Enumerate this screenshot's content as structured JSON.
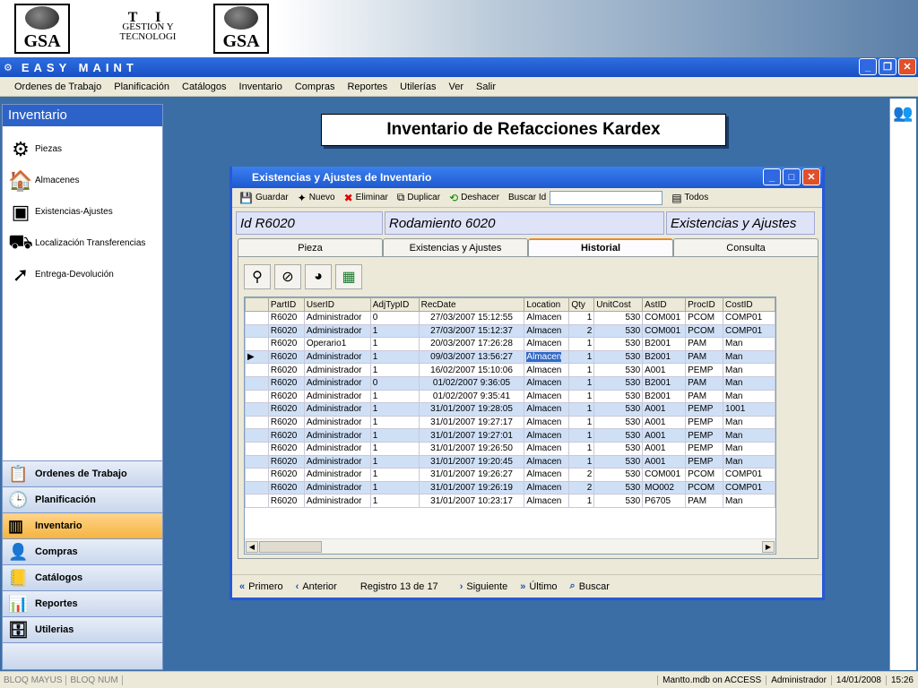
{
  "banner": {
    "logo_text": "GSA",
    "center_line1": "T I",
    "center_line2": "GESTION Y",
    "center_line3": "TECNOLOGI"
  },
  "app_title": "EASY MAINT",
  "menu": [
    "Ordenes de Trabajo",
    "Planificación",
    "Catálogos",
    "Inventario",
    "Compras",
    "Reportes",
    "Utilerías",
    "Ver",
    "Salir"
  ],
  "sidebar": {
    "title": "Inventario",
    "items": [
      {
        "label": "Piezas",
        "icon": "gears-icon"
      },
      {
        "label": "Almacenes",
        "icon": "warehouse-icon"
      },
      {
        "label": "Existencias-Ajustes",
        "icon": "boxes-icon"
      },
      {
        "label": "Localización Transferencias",
        "icon": "forklift-icon"
      },
      {
        "label": "Entrega-Devolución",
        "icon": "delivery-icon"
      }
    ],
    "nav": [
      {
        "label": "Ordenes de Trabajo",
        "active": false
      },
      {
        "label": "Planificación",
        "active": false
      },
      {
        "label": "Inventario",
        "active": true
      },
      {
        "label": "Compras",
        "active": false
      },
      {
        "label": "Catálogos",
        "active": false
      },
      {
        "label": "Reportes",
        "active": false
      },
      {
        "label": "Utilerias",
        "active": false
      }
    ]
  },
  "heading": "Inventario de Refacciones Kardex",
  "dialog": {
    "title": "Existencias y Ajustes de Inventario",
    "toolbar": {
      "save": "Guardar",
      "new": "Nuevo",
      "delete": "Eliminar",
      "duplicate": "Duplicar",
      "undo": "Deshacer",
      "search_id": "Buscar Id",
      "search_value": "",
      "all": "Todos"
    },
    "id_label": "Id R6020",
    "description": "Rodamiento 6020",
    "section": "Existencias y Ajustes",
    "tabs": [
      "Pieza",
      "Existencias y Ajustes",
      "Historial",
      "Consulta"
    ],
    "active_tab": 2,
    "columns": [
      "PartID",
      "UserID",
      "AdjTypID",
      "RecDate",
      "Location",
      "Qty",
      "UnitCost",
      "AstID",
      "ProcID",
      "CostID"
    ],
    "rows": [
      [
        "R6020",
        "Administrador",
        "0",
        "27/03/2007 15:12:55",
        "Almacen",
        "1",
        "530",
        "COM001",
        "PCOM",
        "COMP01"
      ],
      [
        "R6020",
        "Administrador",
        "1",
        "27/03/2007 15:12:37",
        "Almacen",
        "2",
        "530",
        "COM001",
        "PCOM",
        "COMP01"
      ],
      [
        "R6020",
        "Operario1",
        "1",
        "20/03/2007 17:26:28",
        "Almacen",
        "1",
        "530",
        "B2001",
        "PAM",
        "Man"
      ],
      [
        "R6020",
        "Administrador",
        "1",
        "09/03/2007 13:56:27",
        "Almacen",
        "1",
        "530",
        "B2001",
        "PAM",
        "Man"
      ],
      [
        "R6020",
        "Administrador",
        "1",
        "16/02/2007 15:10:06",
        "Almacen",
        "1",
        "530",
        "A001",
        "PEMP",
        "Man"
      ],
      [
        "R6020",
        "Administrador",
        "0",
        "01/02/2007 9:36:05",
        "Almacen",
        "1",
        "530",
        "B2001",
        "PAM",
        "Man"
      ],
      [
        "R6020",
        "Administrador",
        "1",
        "01/02/2007 9:35:41",
        "Almacen",
        "1",
        "530",
        "B2001",
        "PAM",
        "Man"
      ],
      [
        "R6020",
        "Administrador",
        "1",
        "31/01/2007 19:28:05",
        "Almacen",
        "1",
        "530",
        "A001",
        "PEMP",
        "1001"
      ],
      [
        "R6020",
        "Administrador",
        "1",
        "31/01/2007 19:27:17",
        "Almacen",
        "1",
        "530",
        "A001",
        "PEMP",
        "Man"
      ],
      [
        "R6020",
        "Administrador",
        "1",
        "31/01/2007 19:27:01",
        "Almacen",
        "1",
        "530",
        "A001",
        "PEMP",
        "Man"
      ],
      [
        "R6020",
        "Administrador",
        "1",
        "31/01/2007 19:26:50",
        "Almacen",
        "1",
        "530",
        "A001",
        "PEMP",
        "Man"
      ],
      [
        "R6020",
        "Administrador",
        "1",
        "31/01/2007 19:20:45",
        "Almacen",
        "1",
        "530",
        "A001",
        "PEMP",
        "Man"
      ],
      [
        "R6020",
        "Administrador",
        "1",
        "31/01/2007 19:26:27",
        "Almacen",
        "2",
        "530",
        "COM001",
        "PCOM",
        "COMP01"
      ],
      [
        "R6020",
        "Administrador",
        "1",
        "31/01/2007 19:26:19",
        "Almacen",
        "2",
        "530",
        "MO002",
        "PCOM",
        "COMP01"
      ],
      [
        "R6020",
        "Administrador",
        "1",
        "31/01/2007 10:23:17",
        "Almacen",
        "1",
        "530",
        "P6705",
        "PAM",
        "Man"
      ]
    ],
    "selected_row": 3,
    "nav": {
      "first": "Primero",
      "prev": "Anterior",
      "record": "Registro 13 de 17",
      "next": "Siguiente",
      "last": "Último",
      "search": "Buscar"
    }
  },
  "status": {
    "caps": "BLOQ MAYUS",
    "num": "BLOQ NUM",
    "db": "Mantto.mdb on ACCESS",
    "user": "Administrador",
    "date": "14/01/2008",
    "time": "15:26"
  }
}
